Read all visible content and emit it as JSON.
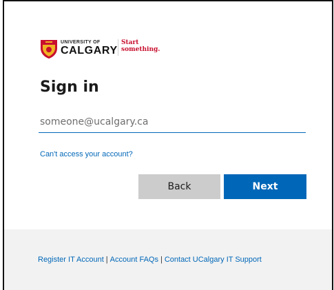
{
  "logo": {
    "university_of": "UNIVERSITY OF",
    "calgary": "CALGARY",
    "tagline_line1": "Start",
    "tagline_line2": "something."
  },
  "signin": {
    "heading": "Sign in",
    "email_placeholder": "someone@ucalgary.ca",
    "email_value": "",
    "cant_access_link": "Can't access your account?"
  },
  "buttons": {
    "back_label": "Back",
    "next_label": "Next"
  },
  "footer": {
    "links": [
      "Register IT Account",
      "Account FAQs",
      "Contact UCalgary IT Support"
    ],
    "separator": "|"
  },
  "colors": {
    "accent": "#0067b8",
    "brand_red": "#c8102e",
    "shield_gold": "#f0b323",
    "back_button": "#cccccc",
    "footer_bg": "#f2f2f2"
  }
}
